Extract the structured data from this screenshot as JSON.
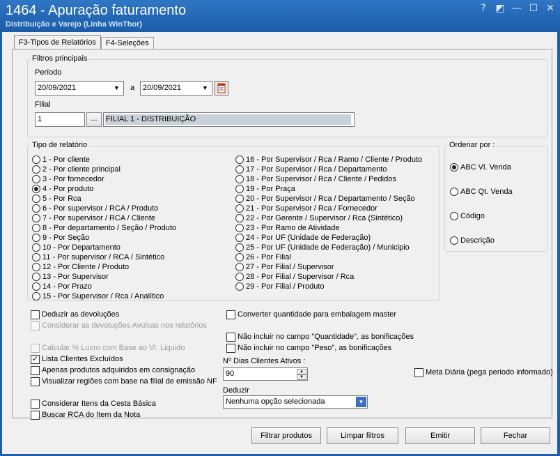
{
  "window": {
    "title": "1464 - Apuração faturamento",
    "subtitle": "Distribuição e Varejo (Linha WinThor)",
    "buttons": [
      "?",
      "◩",
      "—",
      "☐",
      "✕"
    ]
  },
  "tabs": [
    {
      "label": "F3-Tipos de Relatórios"
    },
    {
      "label": "F4-Seleções"
    }
  ],
  "filtros": {
    "group_label": "Filtros principais",
    "periodo_label": "Período",
    "date_from": "20/09/2021",
    "date_sep": "a",
    "date_to": "20/09/2021",
    "filial_label": "Filial",
    "filial_code": "1",
    "filial_browse": "...",
    "filial_name": "FILIAL 1 - DISTRIBUIÇÃO"
  },
  "tipo_relatorio": {
    "group_label": "Tipo de relatório",
    "col1": [
      "1 - Por cliente",
      "2 - Por cliente principal",
      "3 - Por fornecedor",
      "4 - Por produto",
      "5 - Por Rca",
      "6 - Por supervisor / RCA / Produto",
      "7 - Por supervisor / RCA / Cliente",
      "8 - Por departamento / Seção / Produto",
      "9 - Por Seção",
      "10 - Por Departamento",
      "11 - Por supervisor / RCA / Sintético",
      "12 - Por Cliente / Produto",
      "13 - Por Supervisor",
      "14 - Por Prazo",
      "15 - Por Supervisor / Rca / Analítico"
    ],
    "col2": [
      "16 - Por Supervisor / Rca / Ramo /  Cliente / Produto",
      "17 - Por Supervisor / Rca / Departamento",
      "18 - Por Supervisor / Rca / Cliente / Pedidos",
      "19 - Por Praça",
      "20 - Por Supervisor / Rca / Departamento / Seção",
      "21 - Por Supervisor / Rca / Fornecedor",
      "22 - Por Gerente / Supervisor / Rca (Sintético)",
      "23 - Por Ramo de Atividade",
      "24 - Por UF (Unidade de Federação)",
      "25 - Por UF (Unidade de Federação) / Municipio",
      "26 - Por Filial",
      "27 - Por Filial / Supervisor",
      "28 - Por Filial / Supervisor / Rca",
      "29 - Por Filial / Produto"
    ],
    "selected": "4 - Por produto"
  },
  "ordenar": {
    "group_label": "Ordenar por :",
    "options": [
      "ABC Vl. Venda",
      "ABC Qt. Venda",
      "Código",
      "Descrição"
    ],
    "selected": "ABC Vl. Venda"
  },
  "options_left": [
    {
      "label": "Deduzir as devoluções",
      "checked": false,
      "enabled": true
    },
    {
      "label": "Considerar as devoluções Avulsas nos relatórios",
      "checked": false,
      "enabled": false
    },
    {
      "label": "Calcular % Lucro com Base ao Vl. Liquido",
      "checked": false,
      "enabled": false
    },
    {
      "label": "Lista Clientes Excluídos",
      "checked": true,
      "enabled": true
    },
    {
      "label": "Apenas produtos adquiridos em consignação",
      "checked": false,
      "enabled": true
    },
    {
      "label": "Visualizar regiões com base na filial de emissão NF",
      "checked": false,
      "enabled": true
    },
    {
      "label": "Considerar Itens da Cesta Básica",
      "checked": false,
      "enabled": true
    },
    {
      "label": "Buscar RCA do Item da Nota",
      "checked": false,
      "enabled": true
    }
  ],
  "options_mid": [
    {
      "label": "Converter quantidade para embalagem master",
      "checked": false
    },
    {
      "label": "Não incluir no campo \"Quantidade\", as bonificações",
      "checked": false
    },
    {
      "label": "Não incluir no campo \"Peso\", as bonificações",
      "checked": false
    }
  ],
  "dias_clientes": {
    "label": "Nº Dias Clientes Ativos :",
    "value": "90"
  },
  "meta_diaria": {
    "label": "Meta Diária (pega periodo informado)",
    "checked": false
  },
  "deduzir": {
    "label": "Deduzir",
    "value": "Nenhuma opção selecionada"
  },
  "footer_buttons": {
    "filtrar": "Filtrar produtos",
    "limpar": "Limpar filtros",
    "emitir": "Emitir",
    "fechar": "Fechar"
  }
}
